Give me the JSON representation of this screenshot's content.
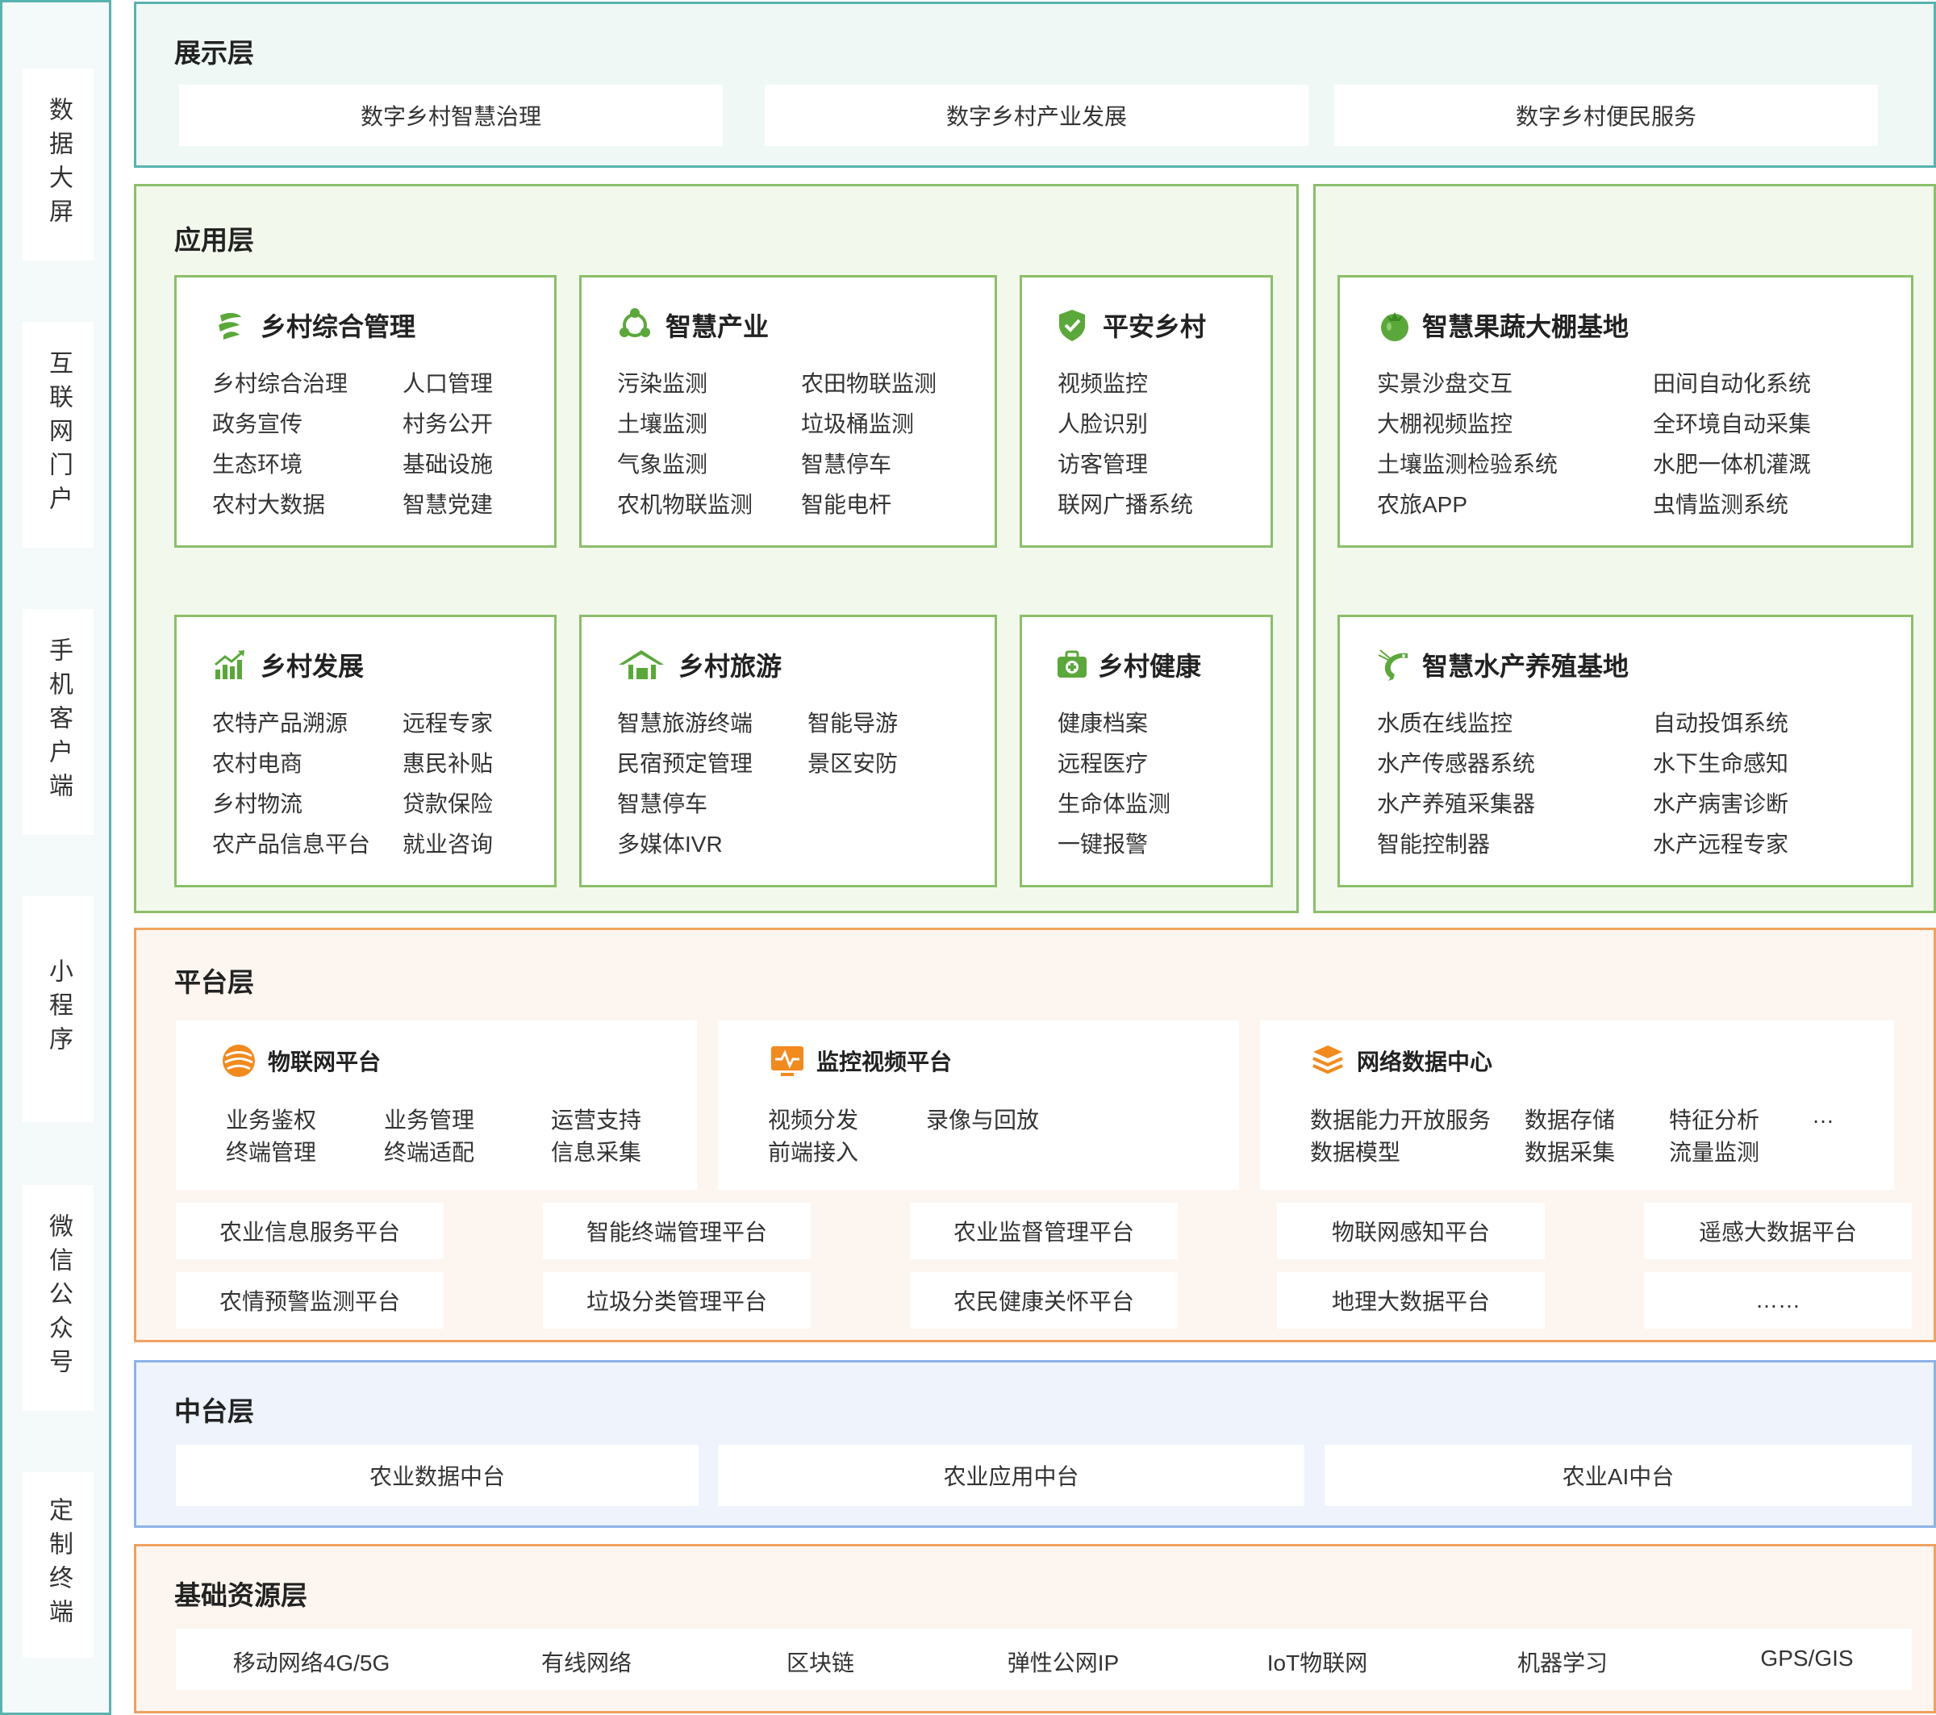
{
  "sidebar": {
    "items": [
      "数据大屏",
      "互联网门户",
      "手机客户端",
      "小程序",
      "微信公众号",
      "定制终端"
    ]
  },
  "display_layer": {
    "title": "展示层",
    "items": [
      "数字乡村智慧治理",
      "数字乡村产业发展",
      "数字乡村便民服务"
    ]
  },
  "app_layer": {
    "title": "应用层",
    "cards": [
      {
        "title": "乡村综合管理",
        "icon": "leaf-swirl-icon",
        "col1": [
          "乡村综合治理",
          "政务宣传",
          "生态环境",
          "农村大数据"
        ],
        "col2": [
          "人口管理",
          "村务公开",
          "基础设施",
          "智慧党建"
        ]
      },
      {
        "title": "智慧产业",
        "icon": "network-nodes-icon",
        "col1": [
          "污染监测",
          "土壤监测",
          "气象监测",
          "农机物联监测"
        ],
        "col2": [
          "农田物联监测",
          "垃圾桶监测",
          "智慧停车",
          "智能电杆"
        ]
      },
      {
        "title": "平安乡村",
        "icon": "shield-check-icon",
        "col1": [
          "视频监控",
          "人脸识别",
          "访客管理",
          "联网广播系统"
        ],
        "col2": []
      },
      {
        "title": "乡村发展",
        "icon": "growth-chart-icon",
        "col1": [
          "农特产品溯源",
          "农村电商",
          "乡村物流",
          "农产品信息平台"
        ],
        "col2": [
          "远程专家",
          "惠民补贴",
          "贷款保险",
          "就业咨询"
        ]
      },
      {
        "title": "乡村旅游",
        "icon": "house-icon",
        "col1": [
          "智慧旅游终端",
          "民宿预定管理",
          "智慧停车",
          "多媒体IVR"
        ],
        "col2": [
          "智能导游",
          "景区安防"
        ]
      },
      {
        "title": "乡村健康",
        "icon": "medical-kit-icon",
        "col1": [
          "健康档案",
          "远程医疗",
          "生命体监测",
          "一键报警"
        ],
        "col2": []
      },
      {
        "title": "智慧果蔬大棚基地",
        "icon": "fruit-icon",
        "col1": [
          "实景沙盘交互",
          "大棚视频监控",
          "土壤监测检验系统",
          "农旅APP"
        ],
        "col2": [
          "田间自动化系统",
          "全环境自动采集",
          "水肥一体机灌溉",
          "虫情监测系统"
        ]
      },
      {
        "title": "智慧水产养殖基地",
        "icon": "shrimp-icon",
        "col1": [
          "水质在线监控",
          "水产传感器系统",
          "水产养殖采集器",
          "智能控制器"
        ],
        "col2": [
          "自动投饵系统",
          "水下生命感知",
          "水产病害诊断",
          "水产远程专家"
        ]
      }
    ]
  },
  "platform_layer": {
    "title": "平台层",
    "panels": [
      {
        "title": "物联网平台",
        "icon": "signal-waves-icon",
        "rows": [
          [
            "业务鉴权",
            "业务管理",
            "运营支持"
          ],
          [
            "终端管理",
            "终端适配",
            "信息采集"
          ]
        ]
      },
      {
        "title": "监控视频平台",
        "icon": "monitor-pulse-icon",
        "rows": [
          [
            "视频分发",
            "录像与回放"
          ],
          [
            "前端接入"
          ]
        ]
      },
      {
        "title": "网络数据中心",
        "icon": "layers-stack-icon",
        "rows": [
          [
            "数据能力开放服务",
            "数据存储",
            "特征分析",
            "…"
          ],
          [
            "数据模型",
            "数据采集",
            "流量监测"
          ]
        ]
      }
    ],
    "grid": [
      [
        "农业信息服务平台",
        "智能终端管理平台",
        "农业监督管理平台",
        "物联网感知平台",
        "遥感大数据平台"
      ],
      [
        "农情预警监测平台",
        "垃圾分类管理平台",
        "农民健康关怀平台",
        "地理大数据平台",
        "……"
      ]
    ]
  },
  "middle_layer": {
    "title": "中台层",
    "items": [
      "农业数据中台",
      "农业应用中台",
      "农业AI中台"
    ]
  },
  "base_layer": {
    "title": "基础资源层",
    "items": [
      "移动网络4G/5G",
      "有线网络",
      "区块链",
      "弹性公网IP",
      "IoT物联网",
      "机器学习",
      "GPS/GIS"
    ]
  },
  "colors": {
    "teal": "#57b3b0",
    "green": "#8bbf6a",
    "icon_green": "#5aa83a",
    "orange": "#f0a260",
    "icon_orange": "#f28a1e",
    "blue": "#8eb2e8"
  }
}
